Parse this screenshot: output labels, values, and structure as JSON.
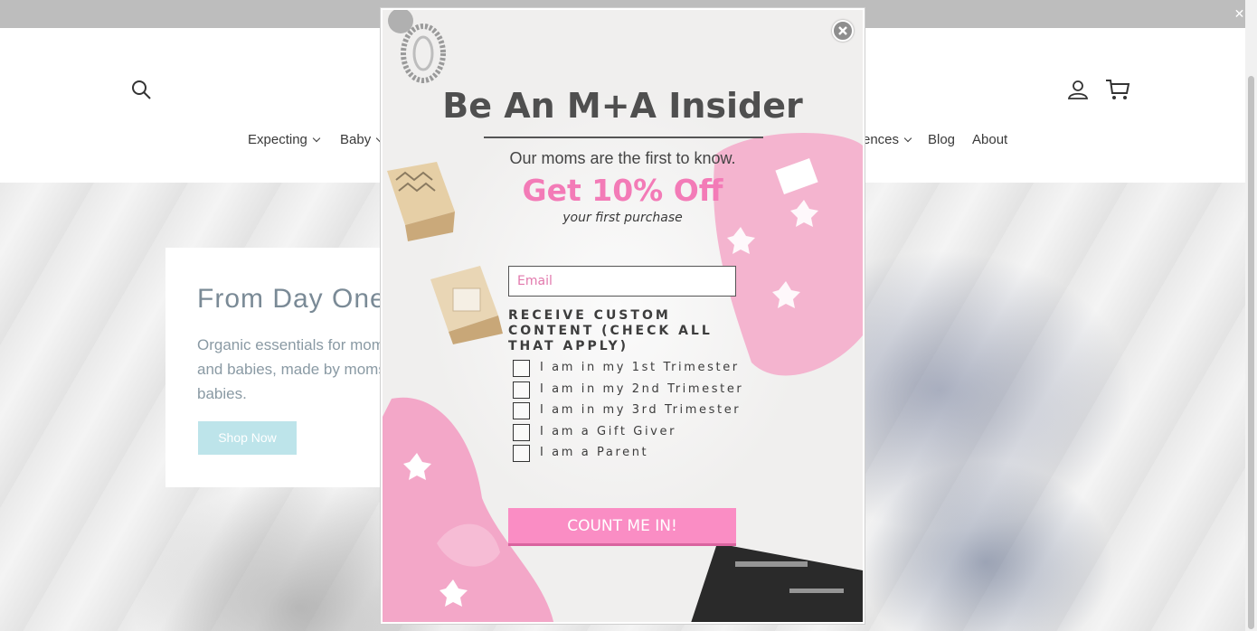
{
  "announcement": {
    "close_glyph": "✕"
  },
  "header": {
    "nav": [
      {
        "label": "Expecting",
        "has_dropdown": true
      },
      {
        "label": "Baby",
        "has_dropdown": true
      },
      {
        "label": "ences",
        "has_dropdown": true
      },
      {
        "label": "Blog",
        "has_dropdown": false
      },
      {
        "label": "About",
        "has_dropdown": false
      }
    ],
    "icons": [
      "search-icon",
      "account-icon",
      "cart-icon"
    ]
  },
  "hero": {
    "title": "From Day One",
    "text": "Organic essentials for moms and babies, made by moms w babies.",
    "button": "Shop Now"
  },
  "popup": {
    "title": "Be An M+A Insider",
    "subtitle": "Our moms are the first to know.",
    "offer": "Get 10% Off",
    "offer_sub": "your first purchase",
    "email_placeholder": "Email",
    "custom_content_label": "RECEIVE CUSTOM CONTENT (CHECK ALL THAT APPLY)",
    "options": [
      "I am in my 1st Trimester",
      "I am in my 2nd Trimester",
      "I am in my 3rd Trimester",
      "I am a Gift Giver",
      "I am a Parent"
    ],
    "submit": "COUNT ME IN!",
    "close_icon": "close-icon"
  },
  "colors": {
    "accent_pink": "#f37bb7",
    "button_pink": "#fa8dc4",
    "hero_button": "#bde4ea",
    "announcement_bar": "#bdbdbd"
  }
}
